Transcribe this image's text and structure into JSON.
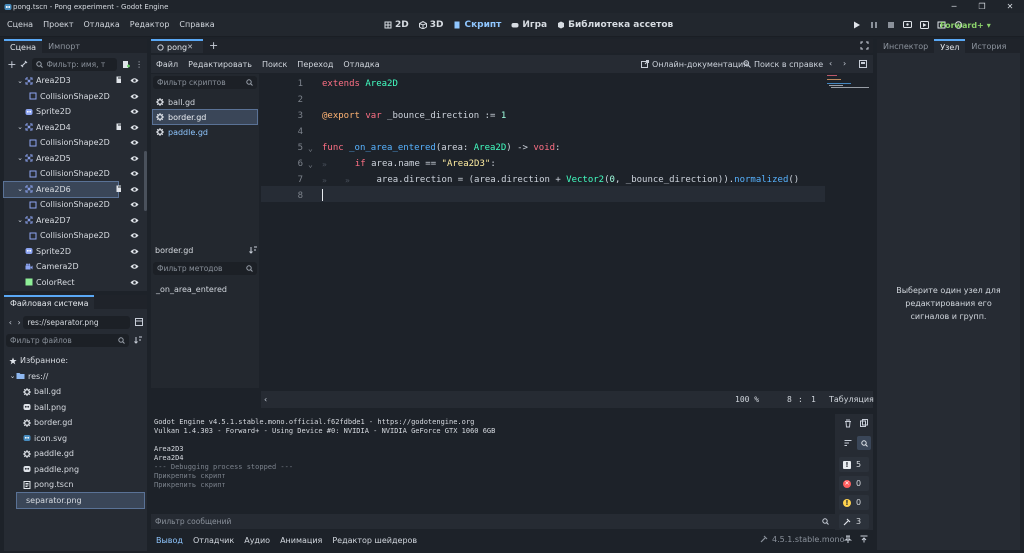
{
  "window": {
    "title": "pong.tscn - Pong experiment - Godot Engine"
  },
  "menu": [
    "Сцена",
    "Проект",
    "Отладка",
    "Редактор",
    "Справка"
  ],
  "workspaces": [
    {
      "label": "2D",
      "icon": "2d-icon"
    },
    {
      "label": "3D",
      "icon": "3d-icon"
    },
    {
      "label": "Скрипт",
      "icon": "script-icon",
      "active": true
    },
    {
      "label": "Игра",
      "icon": "game-icon"
    },
    {
      "label": "Библиотека ассетов",
      "icon": "assetlib-icon"
    }
  ],
  "renderer": "Forward+",
  "scene_panel": {
    "tabs": [
      "Сцена",
      "Импорт"
    ],
    "filter_placeholder": "Фильтр: имя, т",
    "nodes": [
      {
        "name": "Area2D3",
        "type": "area",
        "depth": 1,
        "collapsed": false,
        "script": true
      },
      {
        "name": "CollisionShape2D",
        "type": "shape",
        "depth": 2
      },
      {
        "name": "Sprite2D",
        "type": "sprite",
        "depth": 1
      },
      {
        "name": "Area2D4",
        "type": "area",
        "depth": 1,
        "script": true
      },
      {
        "name": "CollisionShape2D",
        "type": "shape",
        "depth": 2
      },
      {
        "name": "Area2D5",
        "type": "area",
        "depth": 1
      },
      {
        "name": "CollisionShape2D",
        "type": "shape",
        "depth": 2
      },
      {
        "name": "Area2D6",
        "type": "area",
        "depth": 1,
        "script": true,
        "selected": true
      },
      {
        "name": "CollisionShape2D",
        "type": "shape",
        "depth": 2
      },
      {
        "name": "Area2D7",
        "type": "area",
        "depth": 1
      },
      {
        "name": "CollisionShape2D",
        "type": "shape",
        "depth": 2
      },
      {
        "name": "Sprite2D",
        "type": "sprite",
        "depth": 1
      },
      {
        "name": "Camera2D",
        "type": "camera",
        "depth": 1
      },
      {
        "name": "ColorRect",
        "type": "rect",
        "depth": 1
      }
    ]
  },
  "fs_panel": {
    "tab": "Файловая система",
    "path": "res://separator.png",
    "filter_placeholder": "Фильтр файлов",
    "items": [
      {
        "name": "Избранное:",
        "type": "fav",
        "depth": 0
      },
      {
        "name": "res://",
        "type": "folder",
        "depth": 0
      },
      {
        "name": "ball.gd",
        "type": "gd",
        "depth": 1
      },
      {
        "name": "ball.png",
        "type": "png",
        "depth": 1
      },
      {
        "name": "border.gd",
        "type": "gd",
        "depth": 1
      },
      {
        "name": "icon.svg",
        "type": "svg",
        "depth": 1
      },
      {
        "name": "paddle.gd",
        "type": "gd",
        "depth": 1
      },
      {
        "name": "paddle.png",
        "type": "png",
        "depth": 1
      },
      {
        "name": "pong.tscn",
        "type": "tscn",
        "depth": 1
      },
      {
        "name": "separator.png",
        "type": "png",
        "depth": 1,
        "selected": true
      }
    ]
  },
  "editor": {
    "tabs": [
      "pong"
    ],
    "menu": [
      "Файл",
      "Редактировать",
      "Поиск",
      "Переход",
      "Отладка"
    ],
    "online_docs": "Онлайн-документация",
    "search_help": "Поиск в справке",
    "script_filter_placeholder": "Фильтр скриптов",
    "scripts": [
      {
        "name": "ball.gd"
      },
      {
        "name": "border.gd",
        "selected": true
      },
      {
        "name": "paddle.gd"
      }
    ],
    "current_script": "border.gd",
    "method_filter_placeholder": "Фильтр методов",
    "methods": [
      "_on_area_entered"
    ],
    "lines": [
      [
        {
          "t": "extends ",
          "c": "kw"
        },
        {
          "t": "Area2D",
          "c": "ty"
        }
      ],
      [],
      [
        {
          "t": "@export",
          "c": "an"
        },
        {
          "t": " ",
          "c": ""
        },
        {
          "t": "var",
          "c": "kw"
        },
        {
          "t": " _bounce_direction := ",
          "c": ""
        },
        {
          "t": "1",
          "c": "nu"
        }
      ],
      [],
      [
        {
          "t": "func",
          "c": "kw"
        },
        {
          "t": " ",
          "c": ""
        },
        {
          "t": "_on_area_entered",
          "c": "fn"
        },
        {
          "t": "(area: ",
          "c": ""
        },
        {
          "t": "Area2D",
          "c": "ty"
        },
        {
          "t": ") -> ",
          "c": ""
        },
        {
          "t": "void",
          "c": "kw"
        },
        {
          "t": ":",
          "c": ""
        }
      ],
      [
        {
          "t": "  ",
          "c": ""
        },
        {
          "t": "if",
          "c": "kw"
        },
        {
          "t": " area.name == ",
          "c": ""
        },
        {
          "t": "\"Area2D3\"",
          "c": "st"
        },
        {
          "t": ":",
          "c": ""
        }
      ],
      [
        {
          "t": "      area.direction = (area.direction + ",
          "c": ""
        },
        {
          "t": "Vector2",
          "c": "ty"
        },
        {
          "t": "(",
          "c": ""
        },
        {
          "t": "0",
          "c": "nu"
        },
        {
          "t": ", _bounce_direction)).",
          "c": ""
        },
        {
          "t": "normalized",
          "c": "fn"
        },
        {
          "t": "()",
          "c": ""
        }
      ],
      []
    ],
    "zoom": "100 %",
    "line": "8",
    "col": "1",
    "indent": "Табуляция"
  },
  "output": {
    "lines": [
      {
        "t": "Godot Engine v4.5.1.stable.mono.official.f62fdbde1 - https://godotengine.org",
        "c": ""
      },
      {
        "t": "Vulkan 1.4.303 - Forward+ - Using Device #0: NVIDIA - NVIDIA GeForce GTX 1060 6GB",
        "c": ""
      },
      {
        "t": "",
        "c": ""
      },
      {
        "t": "Area2D3",
        "c": ""
      },
      {
        "t": "Area2D4",
        "c": ""
      },
      {
        "t": "--- Debugging process stopped ---",
        "c": "cmt"
      },
      {
        "t": "Прикрепить скрипт",
        "c": "cmt"
      },
      {
        "t": "Прикрепить скрипт",
        "c": "cmt"
      }
    ],
    "filter_placeholder": "Фильтр сообщений",
    "counts": {
      "log": "5",
      "error": "0",
      "warning": "0",
      "editor": "3"
    }
  },
  "bottom_tabs": [
    "Вывод",
    "Отладчик",
    "Аудио",
    "Анимация",
    "Редактор шейдеров"
  ],
  "version": "4.5.1.stable.mono",
  "inspector": {
    "tabs": [
      "Инспектор",
      "Узел",
      "История"
    ],
    "message": "Выберите один узел для редактирования его сигналов и групп."
  },
  "colors": {
    "accent": "#5aa8f5",
    "renderer": "#8bd26b"
  }
}
